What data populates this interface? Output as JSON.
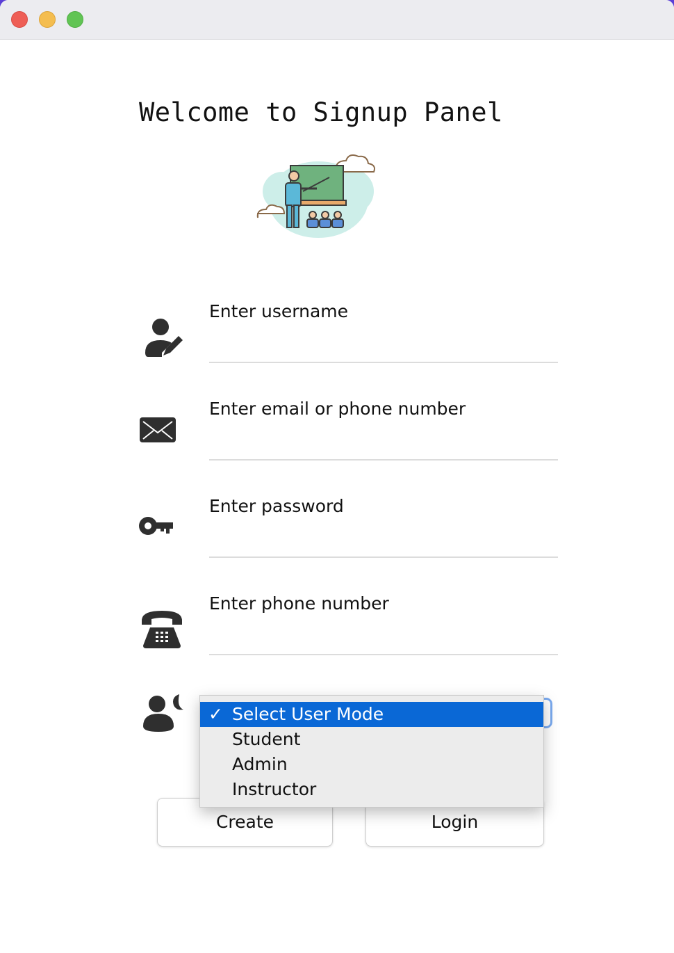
{
  "window": {
    "controls": [
      "close",
      "minimize",
      "maximize"
    ]
  },
  "title": "Welcome to Signup Panel",
  "hero": {
    "icon": "teacher-classroom-illustration"
  },
  "fields": [
    {
      "icon": "user-edit-icon",
      "label": "Enter username",
      "value": ""
    },
    {
      "icon": "envelope-icon",
      "label": "Enter email or phone number",
      "value": ""
    },
    {
      "icon": "key-icon",
      "label": "Enter password",
      "value": ""
    },
    {
      "icon": "telephone-icon",
      "label": "Enter phone number",
      "value": ""
    }
  ],
  "user_mode": {
    "icon": "user-mode-icon",
    "selected": "Select User Mode",
    "options": [
      "Select User Mode",
      "Student",
      "Admin",
      "Instructor"
    ],
    "check_glyph": "✓"
  },
  "buttons": {
    "create": "Create",
    "login": "Login"
  },
  "colors": {
    "selection": "#0a68d6",
    "focus_ring": "#7aaaf0"
  }
}
